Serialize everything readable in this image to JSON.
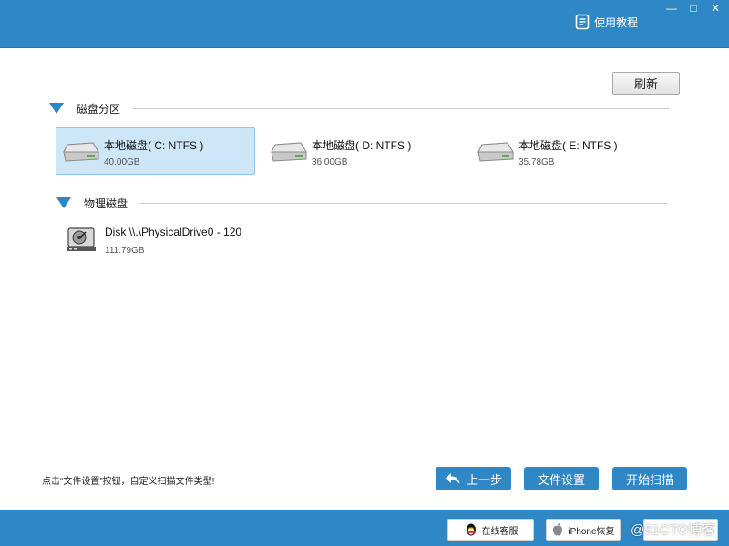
{
  "window": {
    "tutorial_label": "使用教程",
    "minimize": "—",
    "maximize": "□",
    "close": "✕"
  },
  "toolbar": {
    "refresh_label": "刷新"
  },
  "partitions": {
    "title": "磁盘分区",
    "drives": [
      {
        "name": "本地磁盘( C: NTFS )",
        "size": "40.00GB",
        "selected": true
      },
      {
        "name": "本地磁盘( D: NTFS )",
        "size": "36.00GB",
        "selected": false
      },
      {
        "name": "本地磁盘( E: NTFS )",
        "size": "35.78GB",
        "selected": false
      }
    ]
  },
  "physical": {
    "title": "物理磁盘",
    "disks": [
      {
        "name": "Disk \\\\.\\PhysicalDrive0 - 120",
        "size": "111.79GB"
      }
    ]
  },
  "footer": {
    "hint": "点击“文件设置”按钮，自定义扫描文件类型!",
    "prev_label": "上一步",
    "settings_label": "文件设置",
    "start_label": "开始扫描"
  },
  "bottombar": {
    "service_label": "在线客服",
    "iphone_label": "iPhone恢复",
    "watermark": "@51CTO博客"
  },
  "colors": {
    "accent": "#2f87c6",
    "selected_bg": "#cde6f8",
    "triangle": "#2a86c9"
  }
}
